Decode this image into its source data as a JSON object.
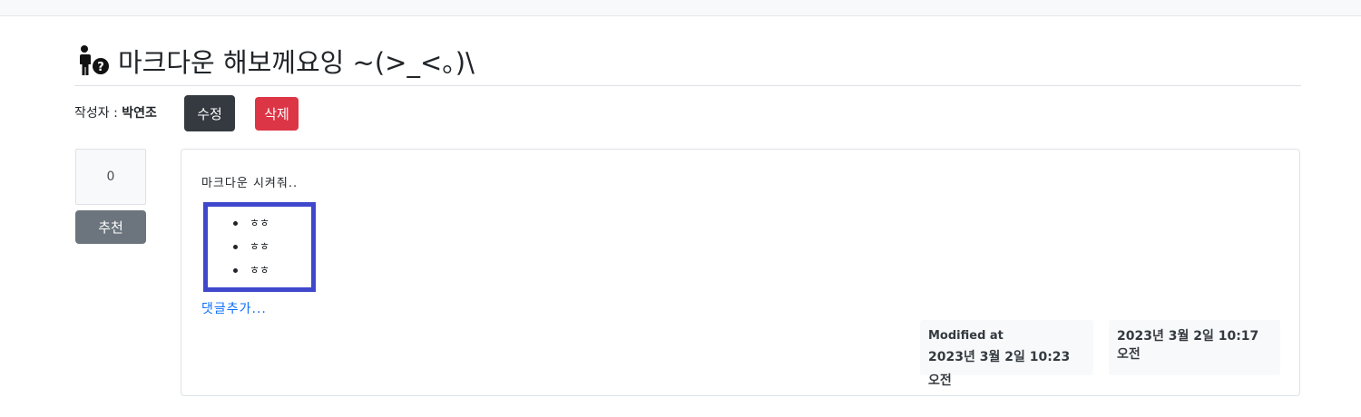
{
  "post": {
    "title": "마크다운 해보께요잉 ~(>_<。)\\",
    "author_prefix": "작성자 : ",
    "author_name": "박연조",
    "edit_label": "수정",
    "delete_label": "삭제"
  },
  "recommend": {
    "count": "0",
    "label": "추천"
  },
  "content": {
    "text": "마크다운 시켜줘..",
    "list_items": [
      "ㅎㅎ",
      "ㅎㅎ",
      "ㅎㅎ"
    ],
    "comment_link": "댓글추가..."
  },
  "meta": {
    "modified_label": "Modified at",
    "modified_value": "2023년 3월 2일 10:23 오전",
    "created_value": "2023년 3월 2일 10:17 오전"
  },
  "icons": {
    "title_icon": "person-question-icon"
  },
  "colors": {
    "edit_button": "#343a40",
    "delete_button": "#dc3545",
    "recommend_button": "#6c757d",
    "link": "#0d6efd",
    "highlight_border": "#3f48cc"
  }
}
